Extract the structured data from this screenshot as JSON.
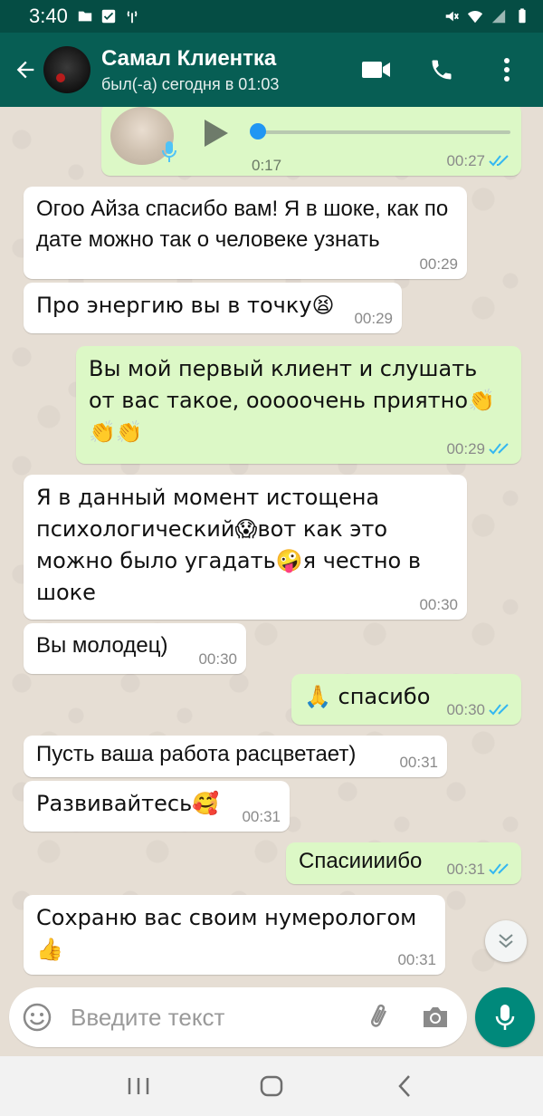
{
  "status_bar": {
    "time": "3:40"
  },
  "header": {
    "contact_name": "Самал Клиентка",
    "last_seen": "был(-а) сегодня в 01:03"
  },
  "voice_message": {
    "duration": "0:17",
    "time": "00:27"
  },
  "messages": [
    {
      "direction": "in",
      "text": "Огоо Айза спасибо вам! Я в шоке, как по дате можно так о человеке узнать",
      "time": "00:29"
    },
    {
      "direction": "in",
      "text": "Про энергию вы в точку😫",
      "time": "00:29"
    },
    {
      "direction": "out",
      "text": "Вы мой первый клиент и слушать от вас такое, ооооочень приятно👏👏👏",
      "time": "00:29"
    },
    {
      "direction": "in",
      "text": "Я в данный момент истощена психологический😱вот как это можно было угадать🤪я честно в шоке",
      "time": "00:30"
    },
    {
      "direction": "in",
      "text": "Вы молодец)",
      "time": "00:30"
    },
    {
      "direction": "out",
      "text": "🙏 спасибо",
      "time": "00:30"
    },
    {
      "direction": "in",
      "text": "Пусть ваша работа расцветает)",
      "time": "00:31"
    },
    {
      "direction": "in",
      "text": "Развивайтесь🥰",
      "time": "00:31"
    },
    {
      "direction": "out",
      "text": "Спасиииибо",
      "time": "00:31"
    },
    {
      "direction": "in",
      "text": "Сохраню вас своим нумерологом👍",
      "time": "00:31"
    }
  ],
  "input": {
    "placeholder": "Введите текст"
  },
  "colors": {
    "header": "#075e54",
    "status_bar": "#054d44",
    "outgoing_bubble": "#dcf8c6",
    "incoming_bubble": "#ffffff",
    "read_ticks": "#34b7f1",
    "mic_button": "#00897b"
  },
  "icons": {
    "header_back": "arrow-left-icon",
    "header_video": "video-camera-icon",
    "header_call": "phone-icon",
    "header_menu": "more-vertical-icon",
    "input_emoji": "smiley-icon",
    "input_attach": "paperclip-icon",
    "input_camera": "camera-icon",
    "send_mic": "microphone-icon",
    "scroll_down": "double-chevron-down-icon"
  }
}
